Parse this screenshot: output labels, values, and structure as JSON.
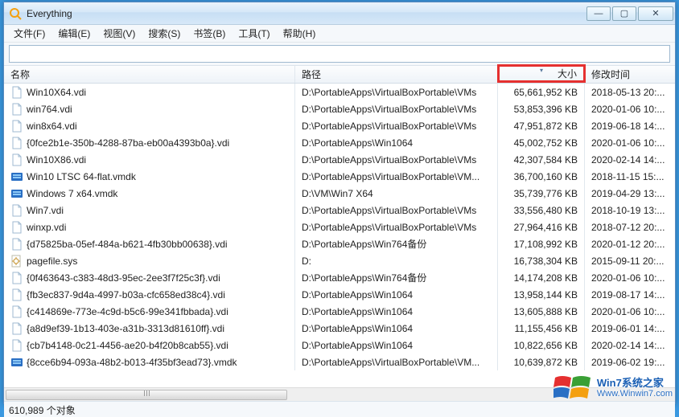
{
  "window": {
    "title": "Everything"
  },
  "menu": {
    "items": [
      "文件(F)",
      "编辑(E)",
      "视图(V)",
      "搜索(S)",
      "书签(B)",
      "工具(T)",
      "帮助(H)"
    ]
  },
  "search": {
    "value": ""
  },
  "columns": {
    "name": "名称",
    "path": "路径",
    "size": "大小",
    "date": "修改时间"
  },
  "files": [
    {
      "icon": "file",
      "name": "Win10X64.vdi",
      "path": "D:\\PortableApps\\VirtualBoxPortable\\VMs",
      "size": "65,661,952 KB",
      "date": "2018-05-13 20:..."
    },
    {
      "icon": "file",
      "name": "win764.vdi",
      "path": "D:\\PortableApps\\VirtualBoxPortable\\VMs",
      "size": "53,853,396 KB",
      "date": "2020-01-06 10:..."
    },
    {
      "icon": "file",
      "name": "win8x64.vdi",
      "path": "D:\\PortableApps\\VirtualBoxPortable\\VMs",
      "size": "47,951,872 KB",
      "date": "2019-06-18 14:..."
    },
    {
      "icon": "file",
      "name": "{0fce2b1e-350b-4288-87ba-eb00a4393b0a}.vdi",
      "path": "D:\\PortableApps\\Win1064",
      "size": "45,002,752 KB",
      "date": "2020-01-06 10:..."
    },
    {
      "icon": "file",
      "name": "Win10X86.vdi",
      "path": "D:\\PortableApps\\VirtualBoxPortable\\VMs",
      "size": "42,307,584 KB",
      "date": "2020-02-14 14:..."
    },
    {
      "icon": "vmdk",
      "name": "Win10 LTSC 64-flat.vmdk",
      "path": "D:\\PortableApps\\VirtualBoxPortable\\VM...",
      "size": "36,700,160 KB",
      "date": "2018-11-15 15:..."
    },
    {
      "icon": "vmdk",
      "name": "Windows 7 x64.vmdk",
      "path": "D:\\VM\\Win7 X64",
      "size": "35,739,776 KB",
      "date": "2019-04-29 13:..."
    },
    {
      "icon": "file",
      "name": "Win7.vdi",
      "path": "D:\\PortableApps\\VirtualBoxPortable\\VMs",
      "size": "33,556,480 KB",
      "date": "2018-10-19 13:..."
    },
    {
      "icon": "file",
      "name": "winxp.vdi",
      "path": "D:\\PortableApps\\VirtualBoxPortable\\VMs",
      "size": "27,964,416 KB",
      "date": "2018-07-12 20:..."
    },
    {
      "icon": "file",
      "name": "{d75825ba-05ef-484a-b621-4fb30bb00638}.vdi",
      "path": "D:\\PortableApps\\Win764备份",
      "size": "17,108,992 KB",
      "date": "2020-01-12 20:..."
    },
    {
      "icon": "sys",
      "name": "pagefile.sys",
      "path": "D:",
      "size": "16,738,304 KB",
      "date": "2015-09-11 20:..."
    },
    {
      "icon": "file",
      "name": "{0f463643-c383-48d3-95ec-2ee3f7f25c3f}.vdi",
      "path": "D:\\PortableApps\\Win764备份",
      "size": "14,174,208 KB",
      "date": "2020-01-06 10:..."
    },
    {
      "icon": "file",
      "name": "{fb3ec837-9d4a-4997-b03a-cfc658ed38c4}.vdi",
      "path": "D:\\PortableApps\\Win1064",
      "size": "13,958,144 KB",
      "date": "2019-08-17 14:..."
    },
    {
      "icon": "file",
      "name": "{c414869e-773e-4c9d-b5c6-99e341fbbada}.vdi",
      "path": "D:\\PortableApps\\Win1064",
      "size": "13,605,888 KB",
      "date": "2020-01-06 10:..."
    },
    {
      "icon": "file",
      "name": "{a8d9ef39-1b13-403e-a31b-3313d81610ff}.vdi",
      "path": "D:\\PortableApps\\Win1064",
      "size": "11,155,456 KB",
      "date": "2019-06-01 14:..."
    },
    {
      "icon": "file",
      "name": "{cb7b4148-0c21-4456-ae20-b4f20b8cab55}.vdi",
      "path": "D:\\PortableApps\\Win1064",
      "size": "10,822,656 KB",
      "date": "2020-02-14 14:..."
    },
    {
      "icon": "vmdk",
      "name": "{8cce6b94-093a-48b2-b013-4f35bf3ead73}.vmdk",
      "path": "D:\\PortableApps\\VirtualBoxPortable\\VM...",
      "size": "10,639,872 KB",
      "date": "2019-06-02 19:..."
    }
  ],
  "status": {
    "objects": "610,989 个对象"
  },
  "watermark": {
    "line1": "Win7系统之家",
    "line2": "Www.Winwin7.com"
  }
}
